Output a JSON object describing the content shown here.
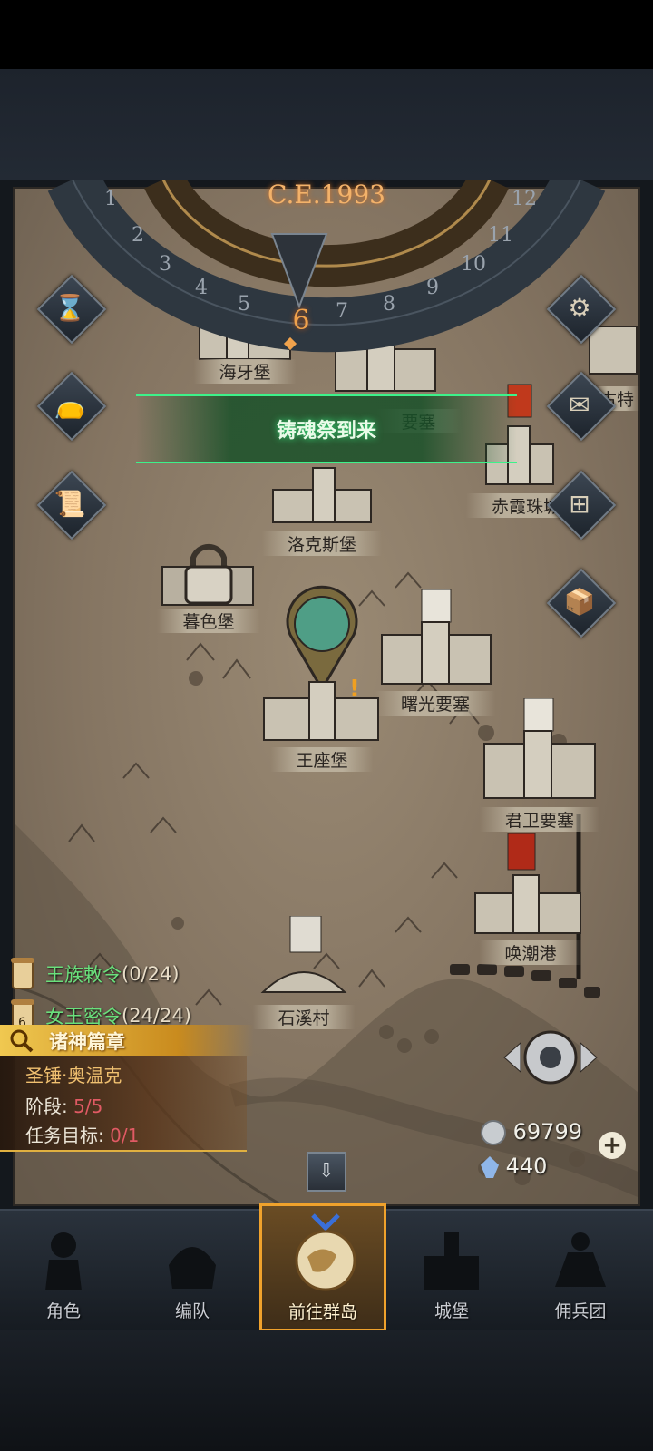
{
  "header": {
    "era": "C.E.1993",
    "current_month": "6",
    "dial_months": [
      "1",
      "2",
      "3",
      "4",
      "5",
      "7",
      "8",
      "9",
      "10",
      "11",
      "12"
    ]
  },
  "event_banner": "铸魂祭到来",
  "locations": {
    "haiya": "海牙堡",
    "yaosai": "要塞",
    "gute": "古特",
    "chixia": "赤霞珠城",
    "luokesi": "洛克斯堡",
    "muse": "暮色堡",
    "shuguang": "曙光要塞",
    "wangzuo": "王座堡",
    "junwei": "君卫要塞",
    "huanchao": "唤潮港",
    "shixi": "石溪村"
  },
  "quests": [
    {
      "title": "王族敕令",
      "count": "(0/24)"
    },
    {
      "title": "女王密令",
      "count": "(24/24)",
      "badge": "6"
    }
  ],
  "saga": {
    "header": "诸神篇章",
    "hero": "圣锤·奥温克",
    "stage_label": "阶段:",
    "stage_value": "5/5",
    "goal_label": "任务目标:",
    "goal_value": "0/1"
  },
  "currency": {
    "silver": "69799",
    "crystal": "440"
  },
  "nav": [
    {
      "label": "角色",
      "icon": "knight-icon"
    },
    {
      "label": "编队",
      "icon": "helmet-icon"
    },
    {
      "label": "前往群岛",
      "icon": "globe-icon"
    },
    {
      "label": "城堡",
      "icon": "castle-icon"
    },
    {
      "label": "佣兵团",
      "icon": "mercenary-icon"
    }
  ],
  "colors": {
    "accent_gold": "#f0a22c",
    "event_green": "#3df28a",
    "quest_green": "#6ae07c",
    "progress_red": "#e05a64"
  }
}
